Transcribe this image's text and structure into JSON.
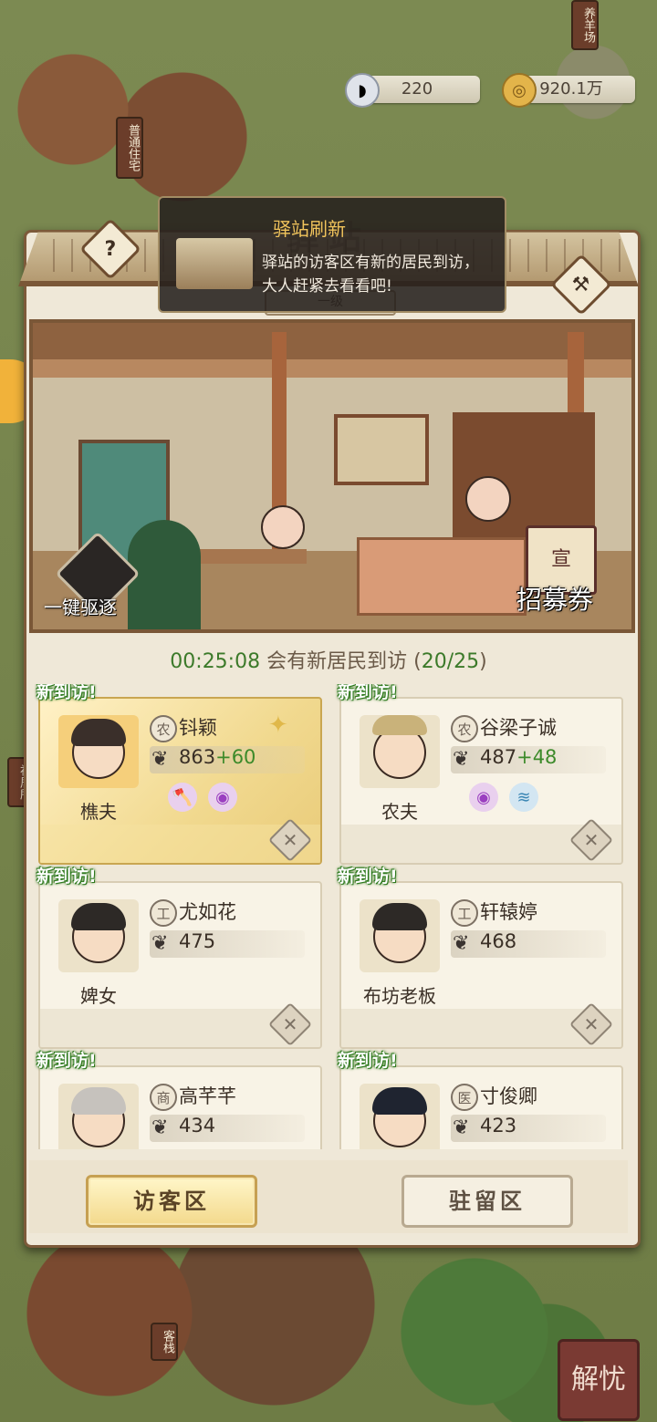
{
  "resources": {
    "silver": {
      "icon": "silver-ingot-icon",
      "value": "220"
    },
    "copper": {
      "icon": "copper-coin-icon",
      "value": "920.1万"
    }
  },
  "map_labels": {
    "sheep_farm": "养羊场",
    "common_house": "普通住宅",
    "inn": "客栈",
    "resident_house": "初居所",
    "corner_badge": "解忧"
  },
  "notification": {
    "title": "驿站刷新",
    "message": "驿站的访客区有新的居民到访，大人赶紧去看看吧!"
  },
  "header": {
    "sign": "驿站",
    "level_text": "一级"
  },
  "scene": {
    "expel_label": "一键驱逐",
    "recruit_label": "招募券",
    "recruit_icon_char": "宣"
  },
  "timer": {
    "countdown": "00:25:08",
    "text": "会有新居民到访",
    "count": "20/25"
  },
  "new_badge": "新到访!",
  "visitors": [
    {
      "name": "钭颖",
      "type_char": "农",
      "job": "樵夫",
      "score": "863",
      "bonus": "+60",
      "skills": [
        "axe-skill-icon",
        "spiral-skill-icon"
      ],
      "highlight": true
    },
    {
      "name": "谷梁子诚",
      "type_char": "农",
      "job": "农夫",
      "score": "487",
      "bonus": "+48",
      "skills": [
        "spiral-skill-icon",
        "fish-skill-icon"
      ],
      "highlight": false
    },
    {
      "name": "尤如花",
      "type_char": "工",
      "job": "婢女",
      "score": "475",
      "bonus": "",
      "skills": [],
      "highlight": false
    },
    {
      "name": "轩辕婷",
      "type_char": "工",
      "job": "布坊老板",
      "score": "468",
      "bonus": "",
      "skills": [],
      "highlight": false
    },
    {
      "name": "高芊芊",
      "type_char": "商",
      "job": "",
      "score": "434",
      "bonus": "",
      "skills": [],
      "highlight": false
    },
    {
      "name": "寸俊卿",
      "type_char": "医",
      "job": "",
      "score": "423",
      "bonus": "",
      "skills": [],
      "highlight": false
    }
  ],
  "tabs": {
    "visitor": "访客区",
    "stay": "驻留区"
  },
  "colors": {
    "accent_green": "#3c7a2a",
    "panel_bg": "#efe8d8",
    "gold": "#f1d98f"
  }
}
